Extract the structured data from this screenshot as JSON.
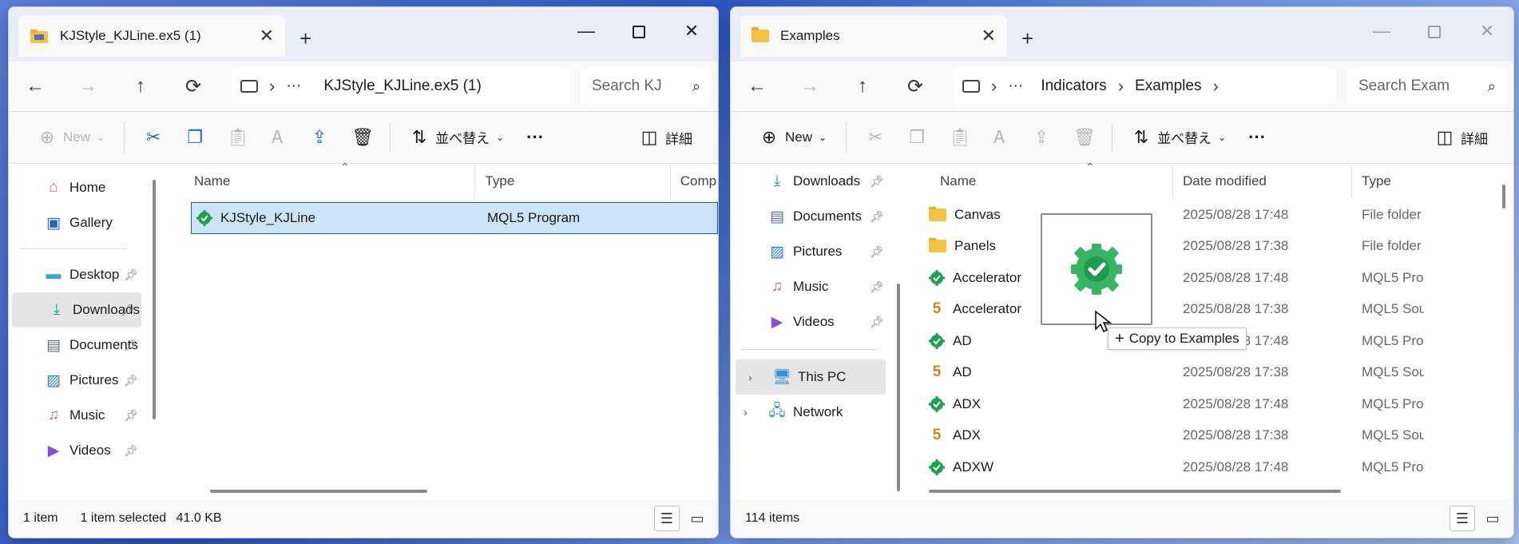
{
  "left_window": {
    "tab_title": "KJStyle_KJLine.ex5 (1)",
    "breadcrumb": [
      "KJStyle_KJLine.ex5 (1)"
    ],
    "ellipsis": "···",
    "search_placeholder": "Search KJ",
    "toolbar": {
      "new_label": "New",
      "sort_label": "並べ替え",
      "more_label": "···",
      "details_label": "詳細"
    },
    "nav": [
      {
        "label": "Home",
        "icon": "home-icon"
      },
      {
        "label": "Gallery",
        "icon": "gallery-icon"
      },
      {
        "label": "Desktop",
        "icon": "desktop-icon",
        "pinned": true
      },
      {
        "label": "Downloads",
        "icon": "download-icon",
        "pinned": true,
        "selected": true
      },
      {
        "label": "Documents",
        "icon": "document-icon",
        "pinned": true
      },
      {
        "label": "Pictures",
        "icon": "picture-icon",
        "pinned": true
      },
      {
        "label": "Music",
        "icon": "music-icon",
        "pinned": true
      },
      {
        "label": "Videos",
        "icon": "video-icon",
        "pinned": true
      }
    ],
    "columns": [
      "Name",
      "Type",
      "Comp"
    ],
    "files": [
      {
        "name": "KJStyle_KJLine",
        "type": "MQL5 Program",
        "icon": "gear-check-icon",
        "selected": true
      }
    ],
    "status": {
      "items": "1 item",
      "selection": "1 item selected",
      "size": "41.0 KB"
    }
  },
  "right_window": {
    "tab_title": "Examples",
    "breadcrumb": [
      "Indicators",
      "Examples"
    ],
    "ellipsis": "···",
    "search_placeholder": "Search Exam",
    "toolbar": {
      "new_label": "New",
      "sort_label": "並べ替え",
      "more_label": "···",
      "details_label": "詳細"
    },
    "nav": [
      {
        "label": "Downloads",
        "icon": "download-icon",
        "pinned": true
      },
      {
        "label": "Documents",
        "icon": "document-icon",
        "pinned": true
      },
      {
        "label": "Pictures",
        "icon": "picture-icon",
        "pinned": true
      },
      {
        "label": "Music",
        "icon": "music-icon",
        "pinned": true
      },
      {
        "label": "Videos",
        "icon": "video-icon",
        "pinned": true
      }
    ],
    "nav_tree": [
      {
        "label": "This PC",
        "icon": "pc-icon",
        "selected": true
      },
      {
        "label": "Network",
        "icon": "network-icon"
      }
    ],
    "columns": [
      "Name",
      "Date modified",
      "Type"
    ],
    "files": [
      {
        "name": "Canvas",
        "date": "2025/08/28 17:48",
        "type": "File folder",
        "icon": "folder"
      },
      {
        "name": "Panels",
        "date": "2025/08/28 17:38",
        "type": "File folder",
        "icon": "folder"
      },
      {
        "name": "Accelerator",
        "date": "2025/08/28 17:48",
        "type": "MQL5 Prog",
        "icon": "program"
      },
      {
        "name": "Accelerator",
        "date": "2025/08/28 17:38",
        "type": "MQL5 Sour",
        "icon": "source"
      },
      {
        "name": "AD",
        "date": "2025/08/28 17:48",
        "type": "MQL5 Prog",
        "icon": "program"
      },
      {
        "name": "AD",
        "date": "2025/08/28 17:38",
        "type": "MQL5 Sour",
        "icon": "source"
      },
      {
        "name": "ADX",
        "date": "2025/08/28 17:48",
        "type": "MQL5 Prog",
        "icon": "program"
      },
      {
        "name": "ADX",
        "date": "2025/08/28 17:38",
        "type": "MQL5 Sour",
        "icon": "source"
      },
      {
        "name": "ADXW",
        "date": "2025/08/28 17:48",
        "type": "MQL5 Prog",
        "icon": "program"
      }
    ],
    "status": {
      "items": "114 items"
    }
  },
  "drag": {
    "tooltip": "Copy to Examples",
    "plus": "+"
  },
  "colors": {
    "accent": "#2166c8",
    "selection": "#cce4f7",
    "program_icon": "#1ea14e",
    "source_icon": "#c98a15"
  }
}
